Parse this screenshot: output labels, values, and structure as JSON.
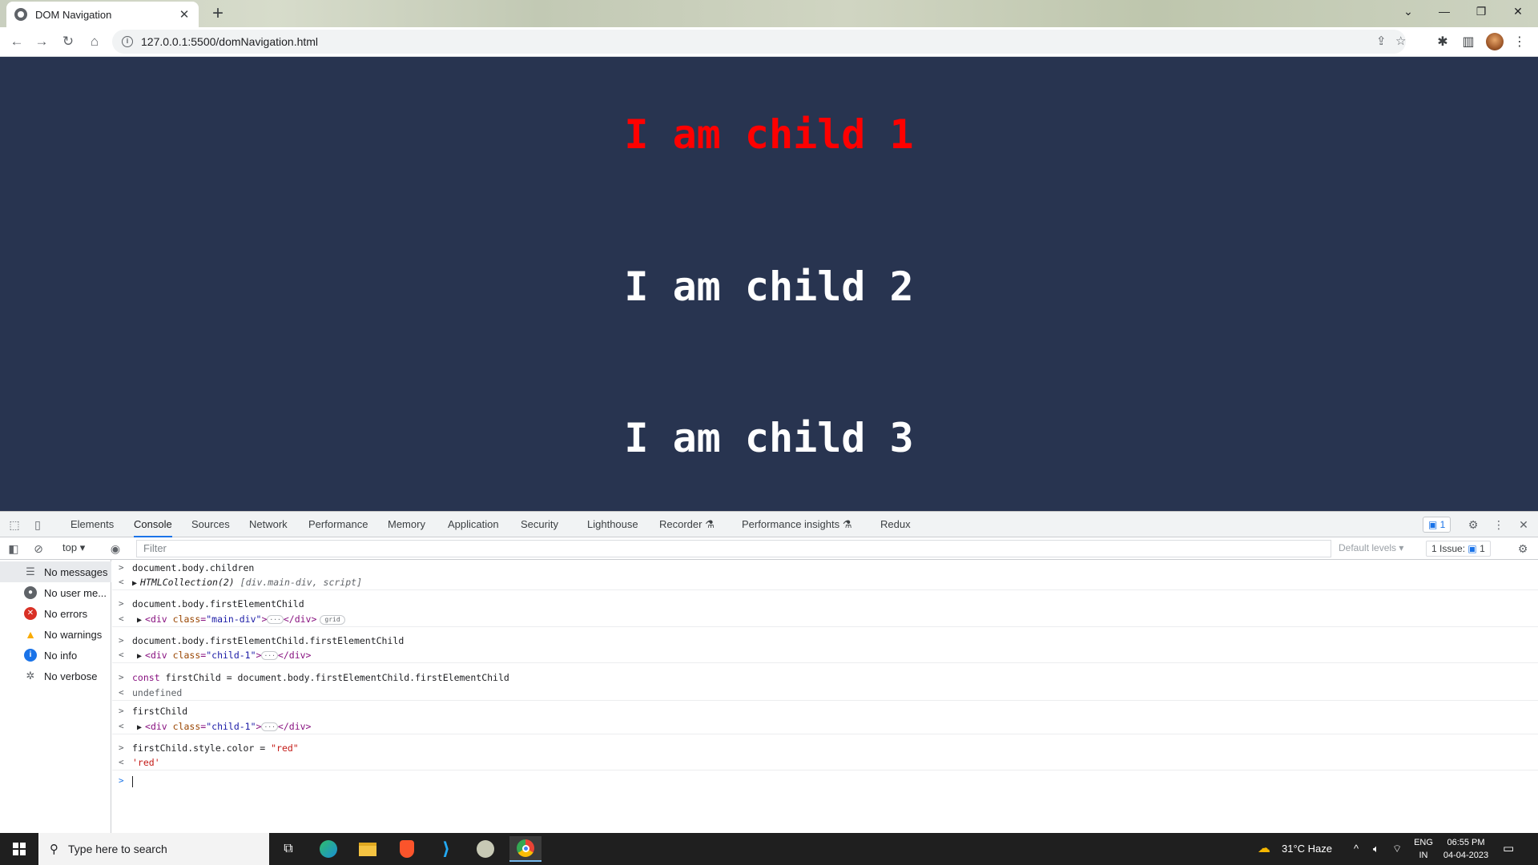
{
  "browser": {
    "tab_title": "DOM Navigation",
    "tab_close": "✕",
    "new_tab": "+",
    "url": "127.0.0.1:5500/domNavigation.html",
    "win_min": "—",
    "win_restore": "❐",
    "win_close": "✕",
    "tab_search": "⌄"
  },
  "page": {
    "child1": "I am child 1",
    "child2": "I am child 2",
    "child3": "I am child 3",
    "child1_color": "#ff0000"
  },
  "devtools": {
    "tabs": [
      "Elements",
      "Console",
      "Sources",
      "Network",
      "Performance",
      "Memory",
      "Application",
      "Security",
      "Lighthouse",
      "Recorder",
      "Performance insights",
      "Redux"
    ],
    "active_tab": "Console",
    "issues_badge": "1",
    "context": "top",
    "filter_placeholder": "Filter",
    "levels": "Default levels",
    "issues_count": "1 Issue:",
    "issues_count_num": "1",
    "sidebar": [
      {
        "label": "No messages"
      },
      {
        "label": "No user me..."
      },
      {
        "label": "No errors"
      },
      {
        "label": "No warnings"
      },
      {
        "label": "No info"
      },
      {
        "label": "No verbose"
      }
    ],
    "console": {
      "c1": "document.body.children",
      "r1_a": "HTMLCollection(2)",
      "r1_b": "[div.main-div, script]",
      "c2": "document.body.firstElementChild",
      "r2_class": "\"main-div\"",
      "r2_badge": "grid",
      "c3": "document.body.firstElementChild.firstElementChild",
      "r3_class": "\"child-1\"",
      "c4_kw": "const",
      "c4_rest": " firstChild = document.body.firstElementChild.firstElementChild",
      "r4": "undefined",
      "c5": "firstChild",
      "r5_class": "\"child-1\"",
      "c6_a": "firstChild.style.color = ",
      "c6_b": "\"red\"",
      "r6": "'red'"
    }
  },
  "taskbar": {
    "search_placeholder": "Type here to search",
    "weather": "31°C  Haze",
    "lang1": "ENG",
    "lang2": "IN",
    "time": "06:55 PM",
    "date": "04-04-2023"
  }
}
